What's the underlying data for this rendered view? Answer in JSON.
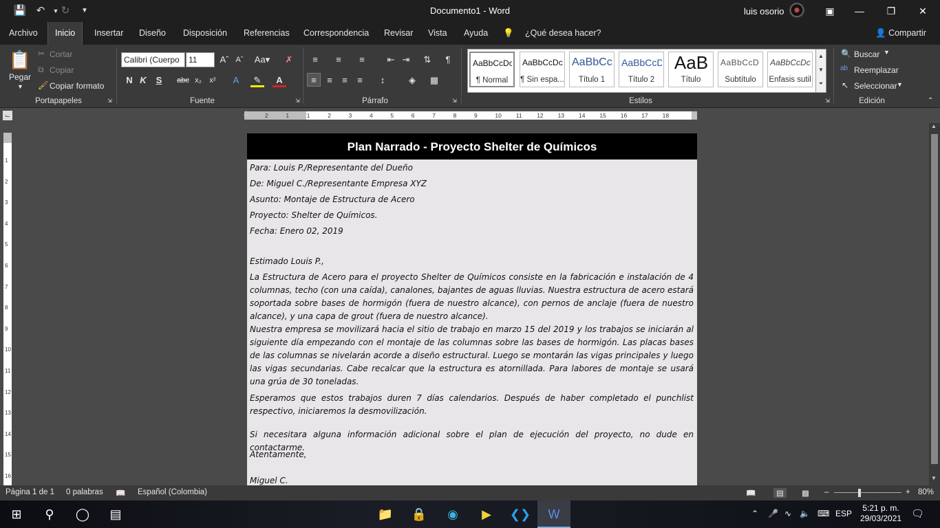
{
  "app": {
    "document_title": "Documento1  -  Word",
    "user_name": "luis osorio",
    "share_label": "Compartir"
  },
  "tabs": [
    "Archivo",
    "Inicio",
    "Insertar",
    "Diseño",
    "Disposición",
    "Referencias",
    "Correspondencia",
    "Revisar",
    "Vista",
    "Ayuda"
  ],
  "tell_me": "¿Qué desea hacer?",
  "ribbon": {
    "clipboard": {
      "paste": "Pegar",
      "cut": "Cortar",
      "copy": "Copiar",
      "format_painter": "Copiar formato",
      "label": "Portapapeles"
    },
    "font": {
      "family": "Calibri (Cuerpo",
      "size": "11",
      "label": "Fuente",
      "bold": "N",
      "italic": "K",
      "underline": "S",
      "strike": "abc"
    },
    "paragraph": {
      "label": "Párrafo"
    },
    "styles": {
      "label": "Estilos",
      "items": [
        {
          "sample": "AaBbCcDc",
          "name": "¶ Normal"
        },
        {
          "sample": "AaBbCcDc",
          "name": "¶ Sin espa..."
        },
        {
          "sample": "AaBbCc",
          "name": "Título 1"
        },
        {
          "sample": "AaBbCcD",
          "name": "Título 2"
        },
        {
          "sample": "AaB",
          "name": "Título"
        },
        {
          "sample": "AaBbCcD",
          "name": "Subtítulo"
        },
        {
          "sample": "AaBbCcDc",
          "name": "Énfasis sutil"
        }
      ]
    },
    "editing": {
      "find": "Buscar",
      "replace": "Reemplazar",
      "select": "Seleccionar",
      "label": "Edición"
    }
  },
  "ruler": {
    "h_numbers": [
      "2",
      "1",
      "1",
      "2",
      "3",
      "4",
      "5",
      "6",
      "7",
      "8",
      "9",
      "10",
      "11",
      "12",
      "13",
      "14",
      "15",
      "16",
      "17",
      "18"
    ],
    "v_numbers": [
      "1",
      "2",
      "3",
      "4",
      "5",
      "6",
      "7",
      "8",
      "9",
      "10",
      "11",
      "12",
      "13",
      "14",
      "15",
      "16"
    ]
  },
  "document": {
    "heading": "Plan Narrado - Proyecto Shelter de Químicos",
    "to": "Para: Louis P./Representante del Dueño",
    "from": "De: Miguel C./Representante Empresa XYZ",
    "subject": "Asunto: Montaje de Estructura de Acero",
    "project": "Proyecto: Shelter de Químicos.",
    "date": "Fecha: Enero 02, 2019",
    "greeting": "Estimado Louis P.,",
    "p1": "La Estructura de Acero para el proyecto Shelter de Químicos consiste en la fabricación e instalación de 4 columnas, techo (con una caída), canalones, bajantes de aguas lluvias. Nuestra estructura de acero estará soportada sobre bases de hormigón (fuera de nuestro alcance), con pernos de anclaje (fuera de nuestro alcance), y una capa de grout (fuera de nuestro alcance).",
    "p2": "Nuestra empresa se movilizará hacia el sitio de trabajo en marzo 15 del 2019 y los trabajos se iniciarán al siguiente día empezando con el montaje de las columnas sobre las bases de hormigón. Las placas bases de las columnas se nivelarán acorde a diseño estructural. Luego se montarán las vigas principales y luego las vigas secundarias. Cabe recalcar que la estructura es atornillada. Para labores de montaje se usará una grúa de 30 toneladas.",
    "p3": "Esperamos que estos trabajos duren 7 días calendarios. Después de haber completado el punchlist respectivo, iniciaremos la desmovilización.",
    "p4": "Si necesitara alguna información adicional sobre el plan de ejecución del proyecto, no dude en contactarme.",
    "closing": "Atentamente,",
    "signature": "Miguel C."
  },
  "status": {
    "page": "Página 1 de 1",
    "words": "0 palabras",
    "language": "Español (Colombia)",
    "zoom": "80%"
  },
  "taskbar": {
    "lang": "ESP",
    "time": "5:21 p. m.",
    "date": "29/03/2021"
  }
}
